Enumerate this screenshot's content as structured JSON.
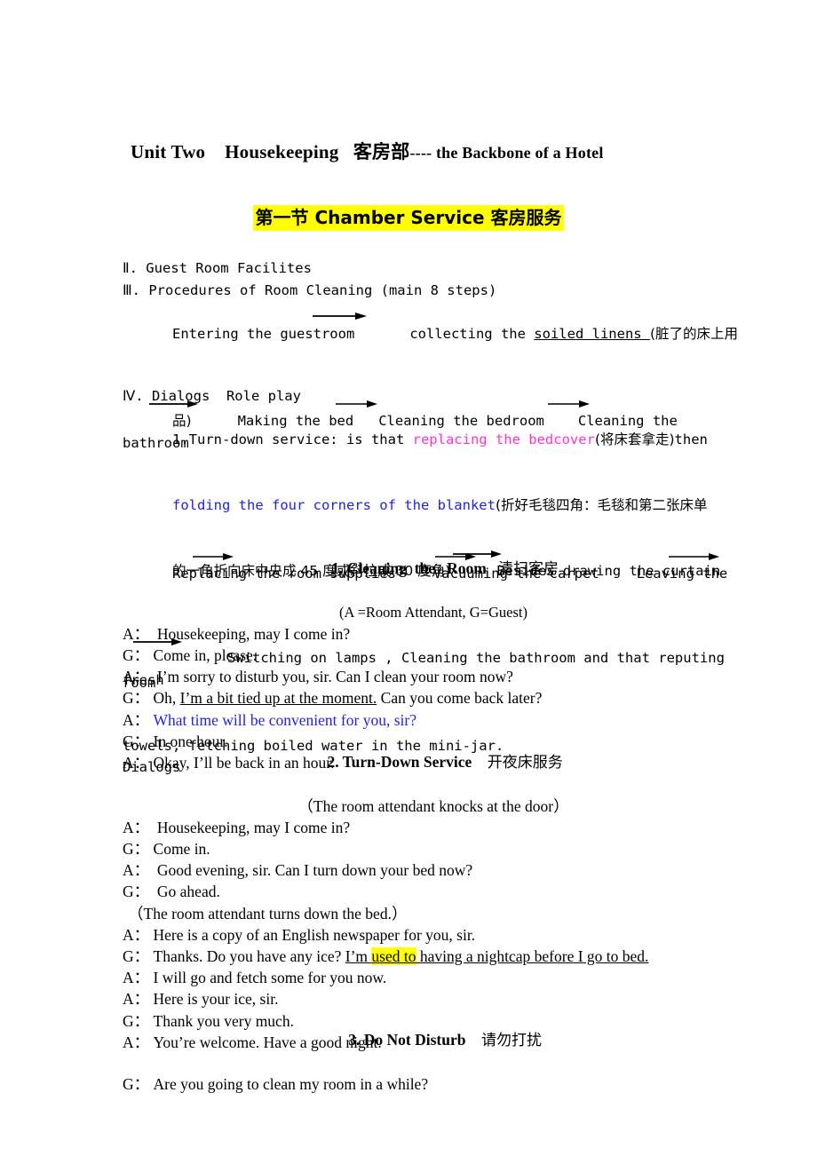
{
  "document": {
    "title": {
      "part1": "Unit Two",
      "part2": "Housekeeping",
      "cn": "客房部",
      "tail": "---- the Backbone of a Hotel"
    },
    "section_header": {
      "text": "第一节 Chamber Service 客房服务",
      "highlight_color": "#FFFF00"
    },
    "outline": {
      "item2": "Ⅱ. Guest Room Facilites",
      "item3": "Ⅲ. Procedures of Room Cleaning (main 8 steps)",
      "steps_line1_a": "Entering the guestroom",
      "steps_line1_b": "collecting the ",
      "steps_line1_underlined": "soiled linens ",
      "steps_line1_cn": "(脏了的床上用",
      "steps_line2_cn": "品)",
      "steps_line2_a": "Making the bed",
      "steps_line2_b": "Cleaning the bedroom",
      "steps_line2_c": "Cleaning the bathroom",
      "steps_line3_a": "Replacing the room supplies",
      "steps_line3_b": "Vacuuming the carpet",
      "steps_line3_c": "Leaving the",
      "steps_line4": "room",
      "item4": "Ⅳ. Dialogs  Role play",
      "turndown_lead": "1.Turn-down service: is that ",
      "turndown_magenta": "replacing the bedcover",
      "turndown_cn1": "(将床套拿走)",
      "turndown_then": "then",
      "turndown_blue": "folding the four corners of the blanket",
      "turndown_cn2": "(折好毛毯四角：毛毯和第二张床单",
      "turndown_cn3": "的一角折向床中央成 45 度或斜拉成 30 度角)",
      "turndown_besides": "Besides drawing the curtain",
      "turndown_switch": "Switching on lamps , Cleaning the bathroom and that reputing fresh",
      "turndown_last": "towels, fetching boiled water in the mini-jar.",
      "dialogs_label": "Dialogs"
    },
    "colors": {
      "magenta": "#FF33CC",
      "blue": "#2222DD",
      "highlight": "#FFFF00",
      "text": "#000000"
    },
    "dialog1": {
      "heading_num": "1. Cleaning",
      "heading_en": "the   Room",
      "heading_cn": "清扫客房",
      "note": "(A =Room Attendant, G=Guest)",
      "lines": [
        {
          "speaker": "A：",
          "text": " Housekeeping, may I come in?"
        },
        {
          "speaker": "G：",
          "text": "Come in, please."
        },
        {
          "speaker": "A：",
          "text": " I’m sorry to disturb you, sir. Can I clean your room now?"
        },
        {
          "speaker": "G：",
          "pre": "Oh, ",
          "underline": "I’m a bit tied up at the moment.",
          "post": " Can you come back later?"
        },
        {
          "speaker": "A：",
          "blue": "What time will be convenient for you, sir?"
        },
        {
          "speaker": "G：",
          "text": "In one hour."
        },
        {
          "speaker": "A：",
          "text": "Okay, I’ll be back in an hour."
        }
      ]
    },
    "dialog2": {
      "heading_num": "2. Turn-Down Service",
      "heading_cn": "开夜床服务",
      "note": "（The room attendant knocks at the door）",
      "lines": [
        {
          "speaker": "A：",
          "text": " Housekeeping, may I come in?"
        },
        {
          "speaker": "G：",
          "text": "Come in."
        },
        {
          "speaker": "A：",
          "text": " Good evening, sir. Can I turn down your bed now?"
        },
        {
          "speaker": "G：",
          "text": " Go ahead."
        }
      ],
      "stage": "（The room attendant turns down the bed.）",
      "lines2": [
        {
          "speaker": "A：",
          "text": "Here is a copy of an English newspaper for you, sir."
        },
        {
          "speaker": "G：",
          "pre": "Thanks. Do you have any ice? ",
          "underline_pre": "I’m ",
          "highlight": "used to",
          "underline_post": " having a nightcap before I go to bed."
        },
        {
          "speaker": "A：",
          "text": "I will go and fetch some for you now."
        },
        {
          "speaker": "A：",
          "text": "Here is your ice, sir."
        },
        {
          "speaker": "G：",
          "text": "Thank you very much."
        },
        {
          "speaker": "A：",
          "text": "You’re welcome. Have a good night."
        }
      ]
    },
    "dialog3": {
      "heading_num": "3. Do Not Disturb",
      "heading_cn": "请勿打扰",
      "lines": [
        {
          "speaker": "G：",
          "text": "Are you going to clean my room in a while?"
        }
      ]
    }
  }
}
